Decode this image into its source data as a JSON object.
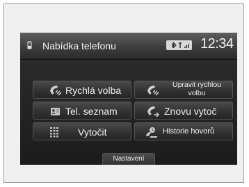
{
  "header": {
    "title": "Nabídka telefonu",
    "clock": "12:34",
    "status_icons": [
      "bluetooth-icon",
      "signal-icon"
    ]
  },
  "menu": {
    "speed_dial": {
      "label": "Rychlá volba",
      "icon": "phone-speed-dial-icon"
    },
    "edit_speed_dial": {
      "label": "Upravit rychlou volbu",
      "icon": "phone-edit-icon"
    },
    "phonebook": {
      "label": "Tel. seznam",
      "icon": "phonebook-icon"
    },
    "redial": {
      "label": "Znovu vytoč",
      "icon": "redial-icon"
    },
    "dial": {
      "label": "Vytočit",
      "icon": "keypad-icon"
    },
    "call_history": {
      "label": "Historie hovorů",
      "icon": "call-history-icon"
    }
  },
  "footer": {
    "settings_label": "Nastavení"
  },
  "colors": {
    "screen_bg": "#1e1e1e",
    "button_text": "#f0f0f0",
    "frame_bg": "#f0f0f0"
  }
}
